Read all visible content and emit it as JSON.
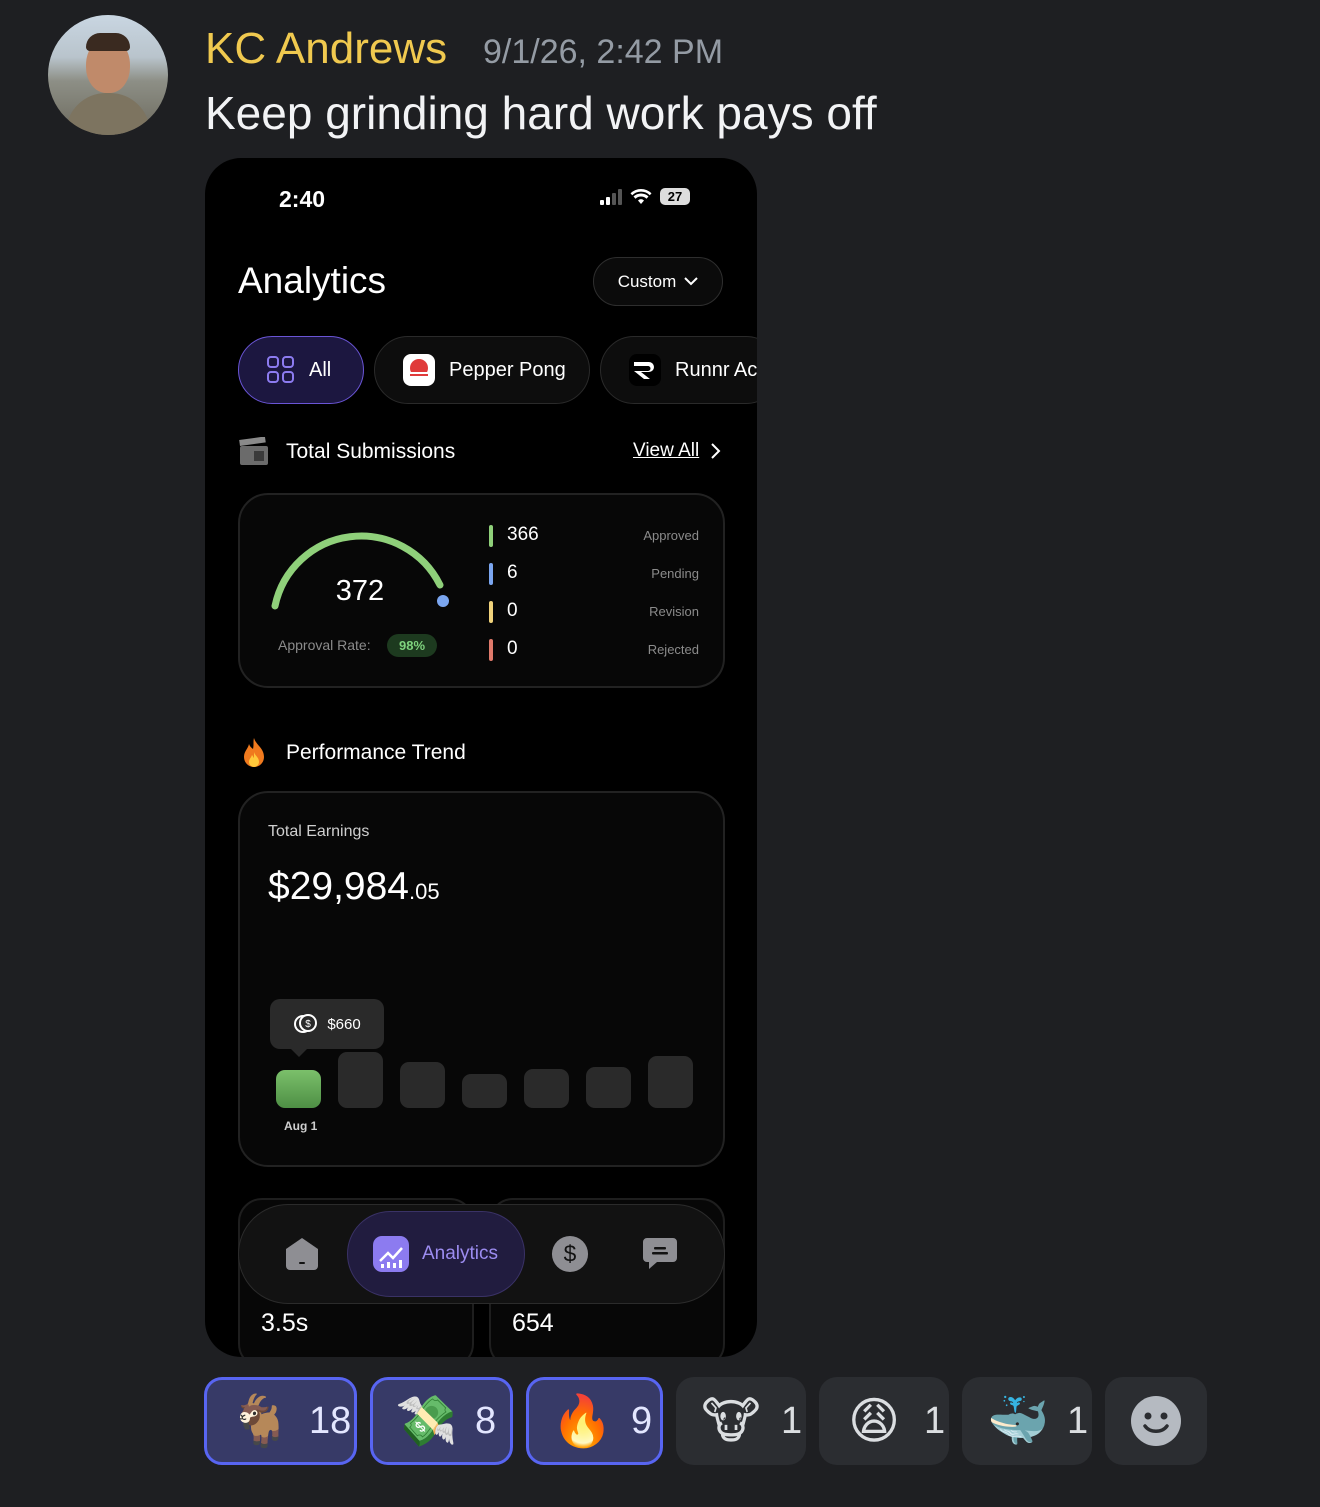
{
  "message": {
    "author": "KC Andrews",
    "timestamp": "9/1/26, 2:42 PM",
    "text": "Keep grinding hard work pays off"
  },
  "phone": {
    "status_time": "2:40",
    "battery": "27",
    "title": "Analytics",
    "range_button": "Custom",
    "chips": [
      {
        "label": "All",
        "icon": "grid-icon"
      },
      {
        "label": "Pepper Pong",
        "icon": "pepper-pong-logo"
      },
      {
        "label": "Runnr Ac",
        "icon": "runnr-logo"
      }
    ],
    "submissions": {
      "heading": "Total Submissions",
      "view_all": "View All",
      "total": "372",
      "approval_rate_label": "Approval Rate:",
      "approval_rate": "98%",
      "breakdown": [
        {
          "value": "366",
          "label": "Approved",
          "color": "#8fd07a"
        },
        {
          "value": "6",
          "label": "Pending",
          "color": "#7ba6f0"
        },
        {
          "value": "0",
          "label": "Revision",
          "color": "#f0d27b"
        },
        {
          "value": "0",
          "label": "Rejected",
          "color": "#e07a6b"
        }
      ]
    },
    "performance": {
      "heading": "Performance Trend",
      "earnings_label": "Total Earnings",
      "earnings_whole": "$29,984",
      "earnings_cents": ".05",
      "tooltip": "$660",
      "first_bar_label": "Aug 1"
    },
    "bottom_cards": [
      "3.5s",
      "654"
    ],
    "tabbar": {
      "active_label": "Analytics"
    }
  },
  "reactions": [
    {
      "emoji": "🐐",
      "name": "goat-emoji",
      "count": "18",
      "mine": true
    },
    {
      "emoji": "💸",
      "name": "money-printer-emoji",
      "count": "8",
      "mine": true
    },
    {
      "emoji": "🔥",
      "name": "fire-emoji",
      "count": "9",
      "mine": true
    },
    {
      "emoji": "🐮",
      "name": "cow-emoji",
      "count": "1",
      "mine": false
    },
    {
      "emoji": "😩",
      "name": "weary-face-emoji",
      "count": "1",
      "mine": false
    },
    {
      "emoji": "🐳",
      "name": "whale-emoji",
      "count": "1",
      "mine": false
    }
  ]
}
